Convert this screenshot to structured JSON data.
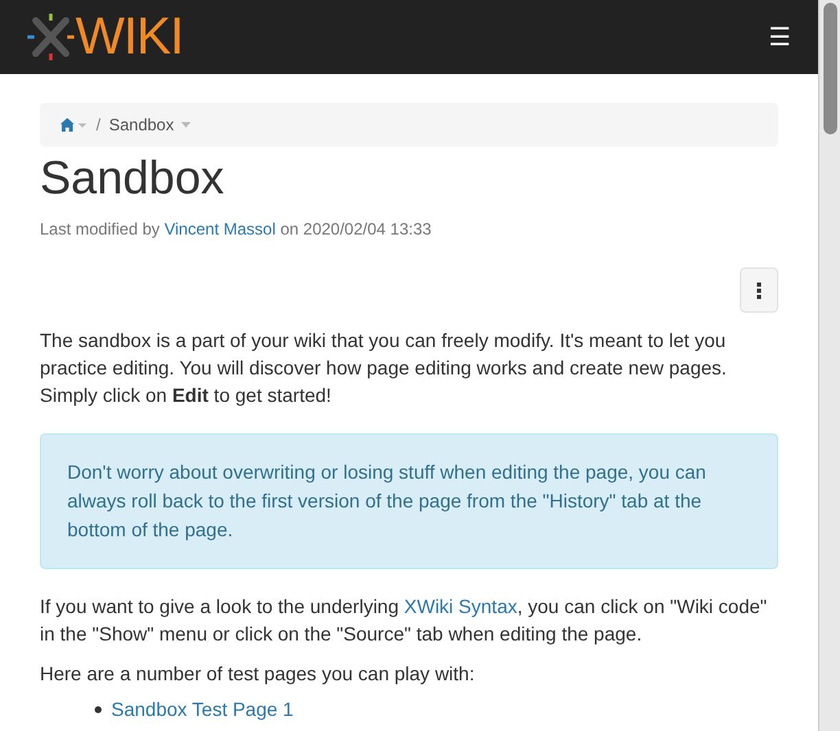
{
  "header": {
    "logo_text": "WIKI",
    "menu_icon": "☰"
  },
  "breadcrumb": {
    "separator": "/",
    "items": [
      {
        "kind": "home"
      },
      {
        "kind": "page",
        "label": "Sandbox"
      }
    ]
  },
  "page": {
    "title": "Sandbox",
    "meta": [
      {
        "kind": "text",
        "text": "Last modified by "
      },
      {
        "kind": "link",
        "text": "Vincent Massol"
      },
      {
        "kind": "text",
        "text": " on 2020/02/04 13:33"
      }
    ],
    "intro": "The sandbox is a part of your wiki that you can freely modify. It's meant to let you practice editing. You will discover how page editing works and create new pages. Simply click on **Edit** to get started!",
    "info_box": "Don't worry about overwriting or losing stuff when editing the page, you can always roll back to the first version of the page from the \"History\" tab at the bottom of the page.",
    "syntax_paragraph": [
      {
        "kind": "text",
        "text": "If you want to give a look to the underlying "
      },
      {
        "kind": "link",
        "text": "XWiki Syntax"
      },
      {
        "kind": "text",
        "text": ", you can click on \"Wiki code\" in the \"Show\" menu or click on the \"Source\" tab when editing the page."
      }
    ],
    "list_intro": "Here are a number of test pages you can play with:",
    "test_pages": [
      "Sandbox Test Page 1"
    ]
  }
}
